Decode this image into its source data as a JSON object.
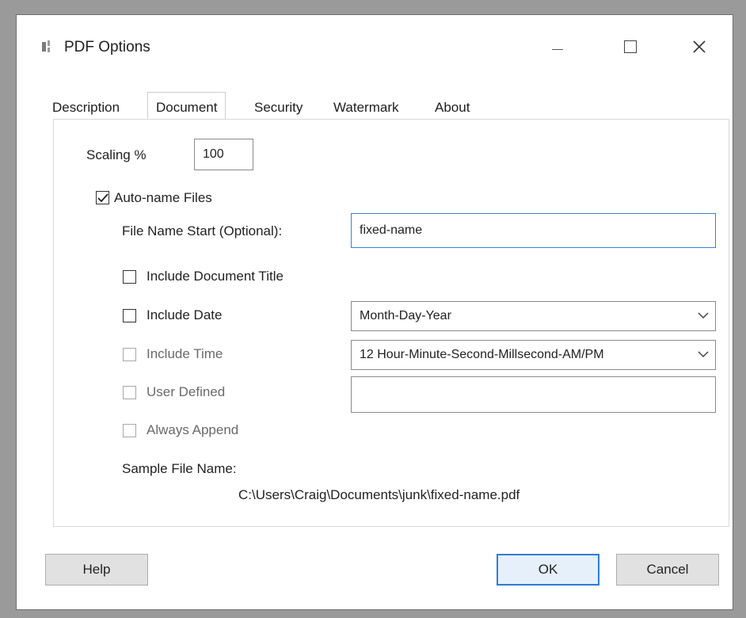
{
  "window": {
    "title": "PDF Options",
    "app_icon": "printer-icon"
  },
  "titlebar_buttons": {
    "minimize_icon": "minimize-icon",
    "maximize_icon": "maximize-icon",
    "close_icon": "close-icon",
    "close_glyph": "✕"
  },
  "tabs": [
    {
      "label": "Description",
      "active": false
    },
    {
      "label": "Document",
      "active": true
    },
    {
      "label": "Security",
      "active": false
    },
    {
      "label": "Watermark",
      "active": false
    },
    {
      "label": "About",
      "active": false
    }
  ],
  "document": {
    "scaling_label": "Scaling %",
    "scaling_value": "100",
    "auto_name": {
      "label": "Auto-name Files",
      "checked": true
    },
    "file_name_start_label": "File Name Start (Optional):",
    "file_name_start_value": "fixed-name",
    "include_title": {
      "label": "Include Document Title",
      "checked": false
    },
    "include_date": {
      "label": "Include Date",
      "checked": false
    },
    "date_format": "Month-Day-Year",
    "include_time": {
      "label": "Include Time",
      "checked": false
    },
    "time_format": "12 Hour-Minute-Second-Millsecond-AM/PM",
    "user_defined": {
      "label": "User Defined",
      "checked": false
    },
    "user_defined_value": "",
    "always_append": {
      "label": "Always Append",
      "checked": false
    },
    "sample_label": "Sample File Name:",
    "sample_value": "C:\\Users\\Craig\\Documents\\junk\\fixed-name.pdf"
  },
  "buttons": {
    "help": "Help",
    "ok": "OK",
    "cancel": "Cancel"
  }
}
